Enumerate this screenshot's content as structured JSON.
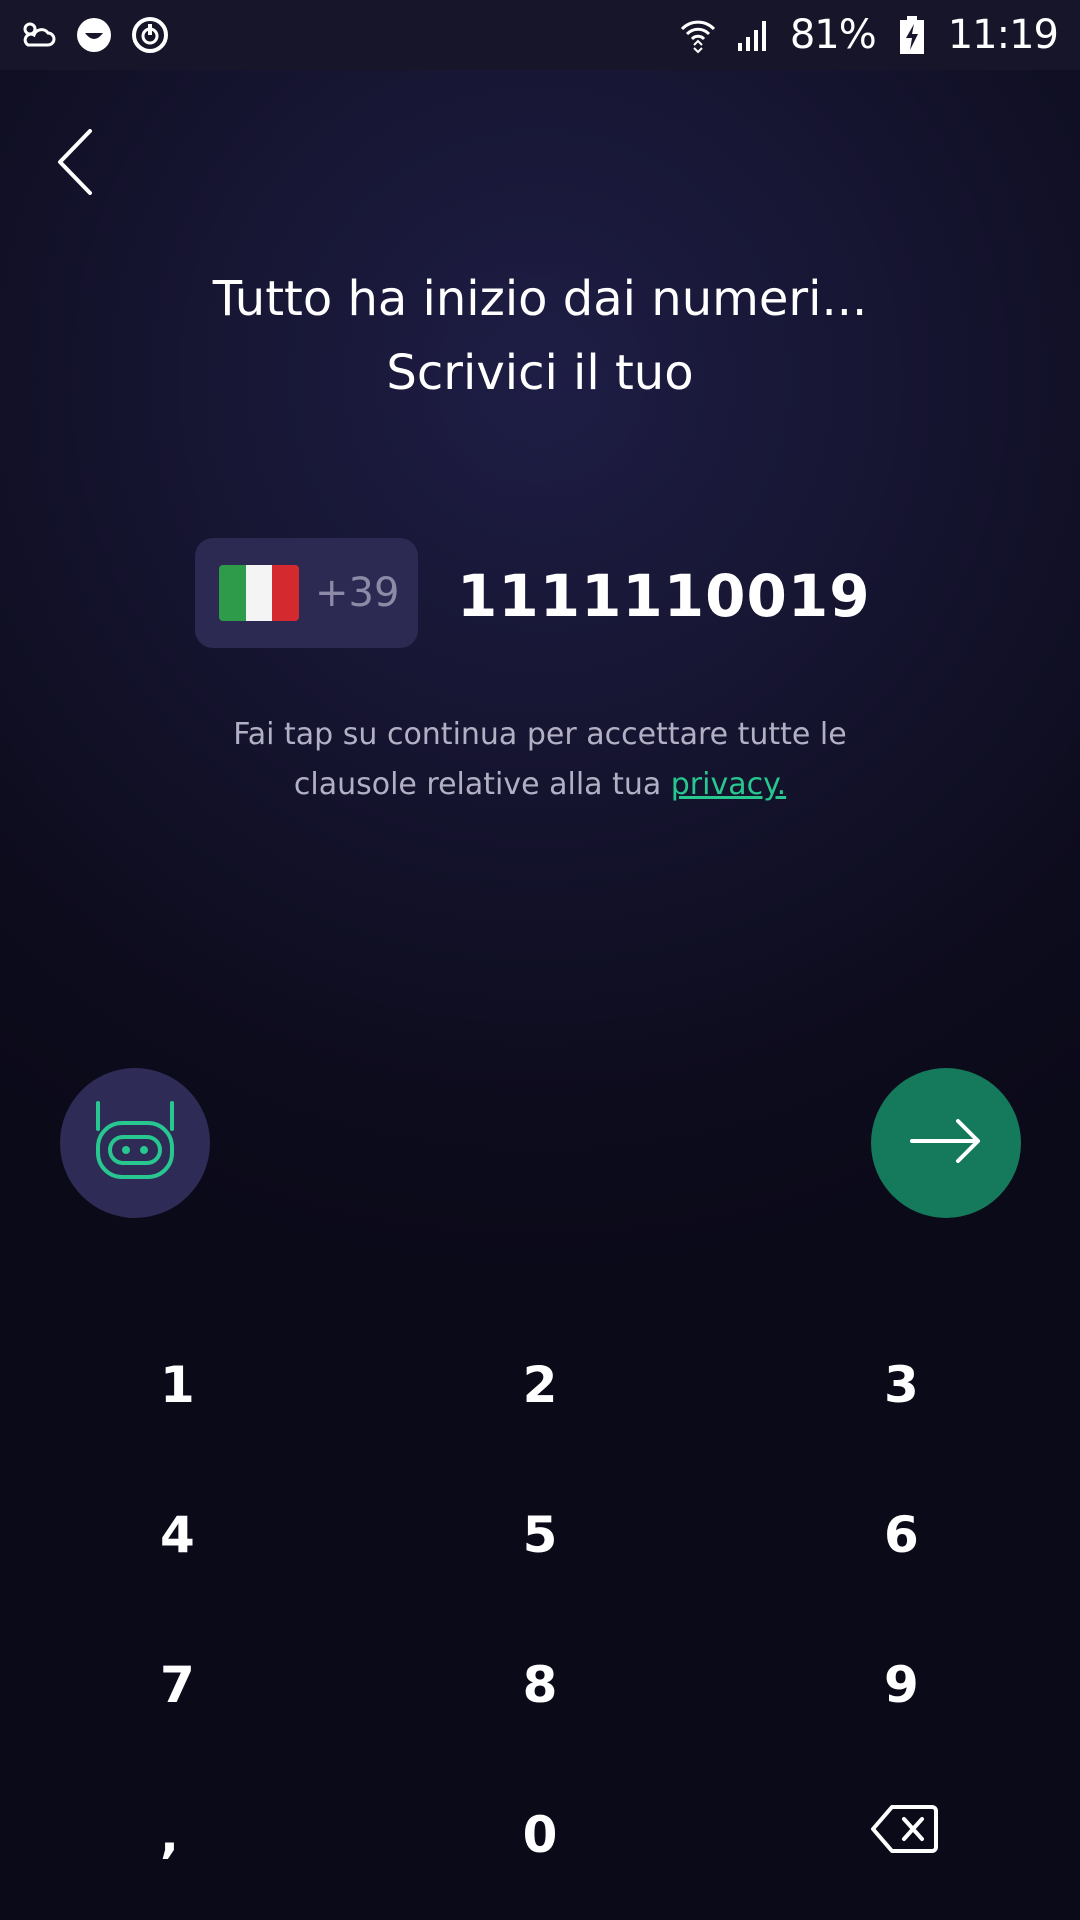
{
  "status_bar": {
    "left_icons": [
      "weather-icon",
      "face-icon",
      "power-timer-icon"
    ],
    "right_icons": [
      "wifi-icon",
      "signal-icon",
      "battery-charging-icon"
    ],
    "battery": "81%",
    "time": "11:19"
  },
  "header": {
    "back_icon": "chevron-left-icon",
    "title_line1": "Tutto ha inizio dai numeri...",
    "title_line2": "Scrivici il tuo"
  },
  "phone_input": {
    "country_flag": "italy-flag-icon",
    "dial_code": "+39",
    "number": "1111110019"
  },
  "privacy": {
    "line1": "Fai tap su continua per accettare tutte le",
    "line2_prefix": "clausole relative alla tua ",
    "link": "privacy."
  },
  "actions": {
    "bot_icon": "robot-face-icon",
    "next_icon": "arrow-right-icon"
  },
  "keypad": {
    "keys": [
      "1",
      "2",
      "3",
      "4",
      "5",
      "6",
      "7",
      "8",
      "9",
      ",",
      "0"
    ],
    "backspace_icon": "backspace-icon"
  },
  "colors": {
    "accent_green": "#27c78f",
    "next_button": "#15795b",
    "picker_bg": "#2c2a52",
    "bot_button_bg": "#2e2c56"
  }
}
